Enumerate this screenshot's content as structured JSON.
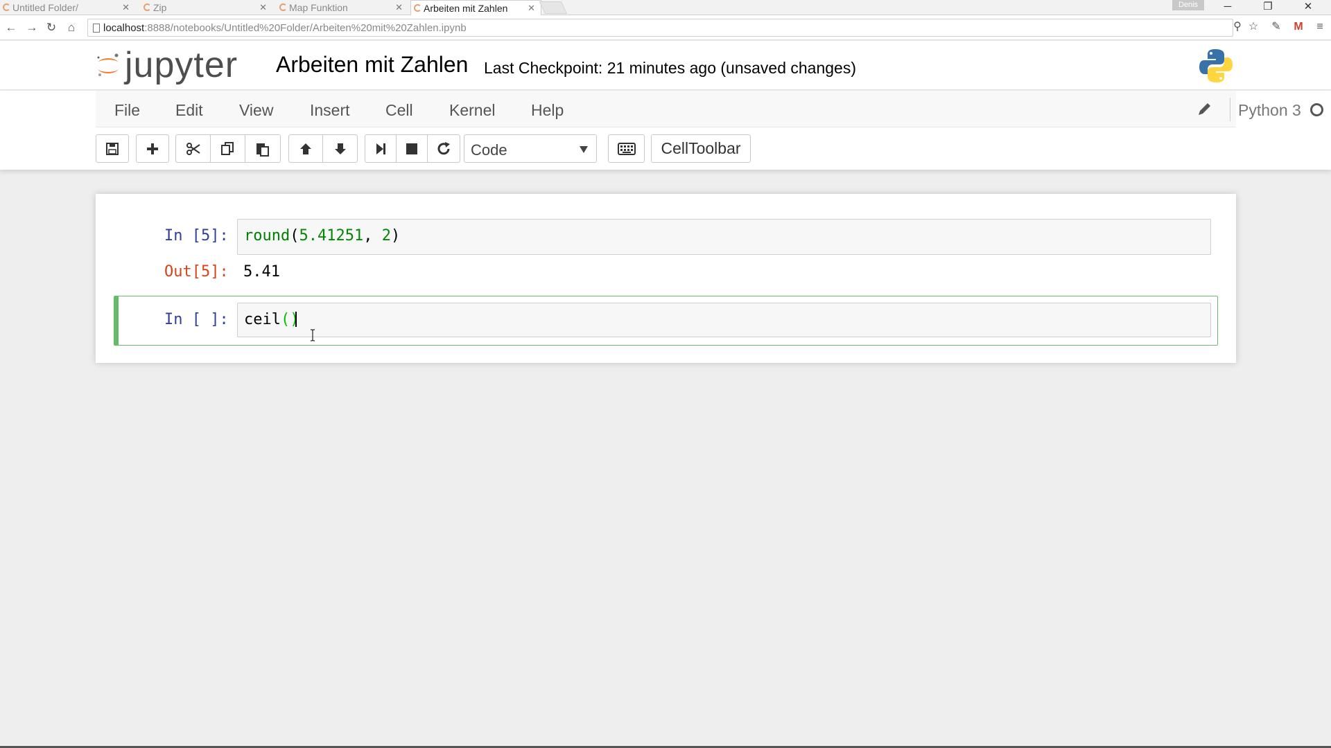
{
  "browser": {
    "tabs": [
      {
        "title": "Untitled Folder/",
        "active": false
      },
      {
        "title": "Zip",
        "active": false
      },
      {
        "title": "Map Funktion",
        "active": false
      },
      {
        "title": "Arbeiten mit Zahlen",
        "active": true
      }
    ],
    "profile": "Denis",
    "url_host": "localhost",
    "url_rest": ":8888/notebooks/Untitled%20Folder/Arbeiten%20mit%20Zahlen.ipynb"
  },
  "header": {
    "logo_text": "jupyter",
    "notebook_title": "Arbeiten mit Zahlen",
    "checkpoint": "Last Checkpoint: 21 minutes ago (unsaved changes)"
  },
  "menubar": {
    "items": [
      "File",
      "Edit",
      "View",
      "Insert",
      "Cell",
      "Kernel",
      "Help"
    ],
    "kernel_name": "Python 3"
  },
  "toolbar": {
    "cell_type": "Code",
    "celltoolbar_label": "CellToolbar"
  },
  "cells": [
    {
      "in_prompt": "In [5]:",
      "code_func": "round",
      "code_open": "(",
      "code_arg1": "5.41251",
      "code_sep": ", ",
      "code_arg2": "2",
      "code_close": ")",
      "out_prompt": "Out[5]:",
      "output": "5.41"
    },
    {
      "in_prompt": "In [ ]:",
      "code_func": "ceil",
      "code_open": "(",
      "code_close": ")"
    }
  ],
  "colors": {
    "prompt_in": "#303f9f",
    "prompt_out": "#d84315",
    "selected_border": "#66bb6a",
    "jupyter_orange": "#f37726"
  }
}
